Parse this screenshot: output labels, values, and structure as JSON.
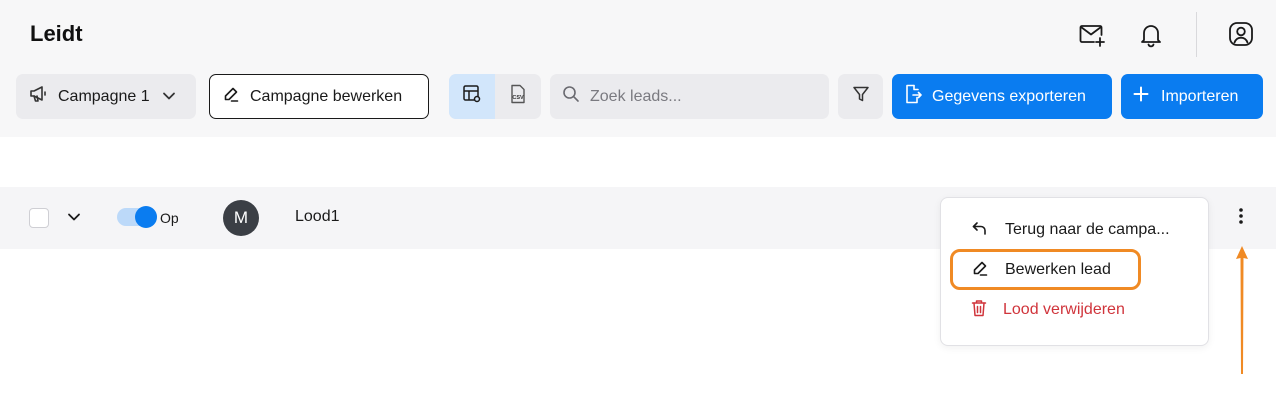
{
  "header": {
    "title": "Leidt"
  },
  "toolbar": {
    "campaign_select": "Campagne 1",
    "edit_campaign": "Campagne bewerken",
    "view_table": "table-view-icon",
    "view_csv": "CSV",
    "search_placeholder": "Zoek leads...",
    "export_label": "Gegevens exporteren",
    "import_label": "Importeren"
  },
  "row": {
    "toggle_label": "Op",
    "avatar_initial": "M",
    "name": "Lood1"
  },
  "context_menu": {
    "back": "Terug naar de campa...",
    "edit_lead": "Bewerken lead",
    "delete_lead": "Lood verwijderen"
  },
  "colors": {
    "primary": "#0a7cf0",
    "highlight": "#f08a24",
    "danger": "#d0343b"
  }
}
